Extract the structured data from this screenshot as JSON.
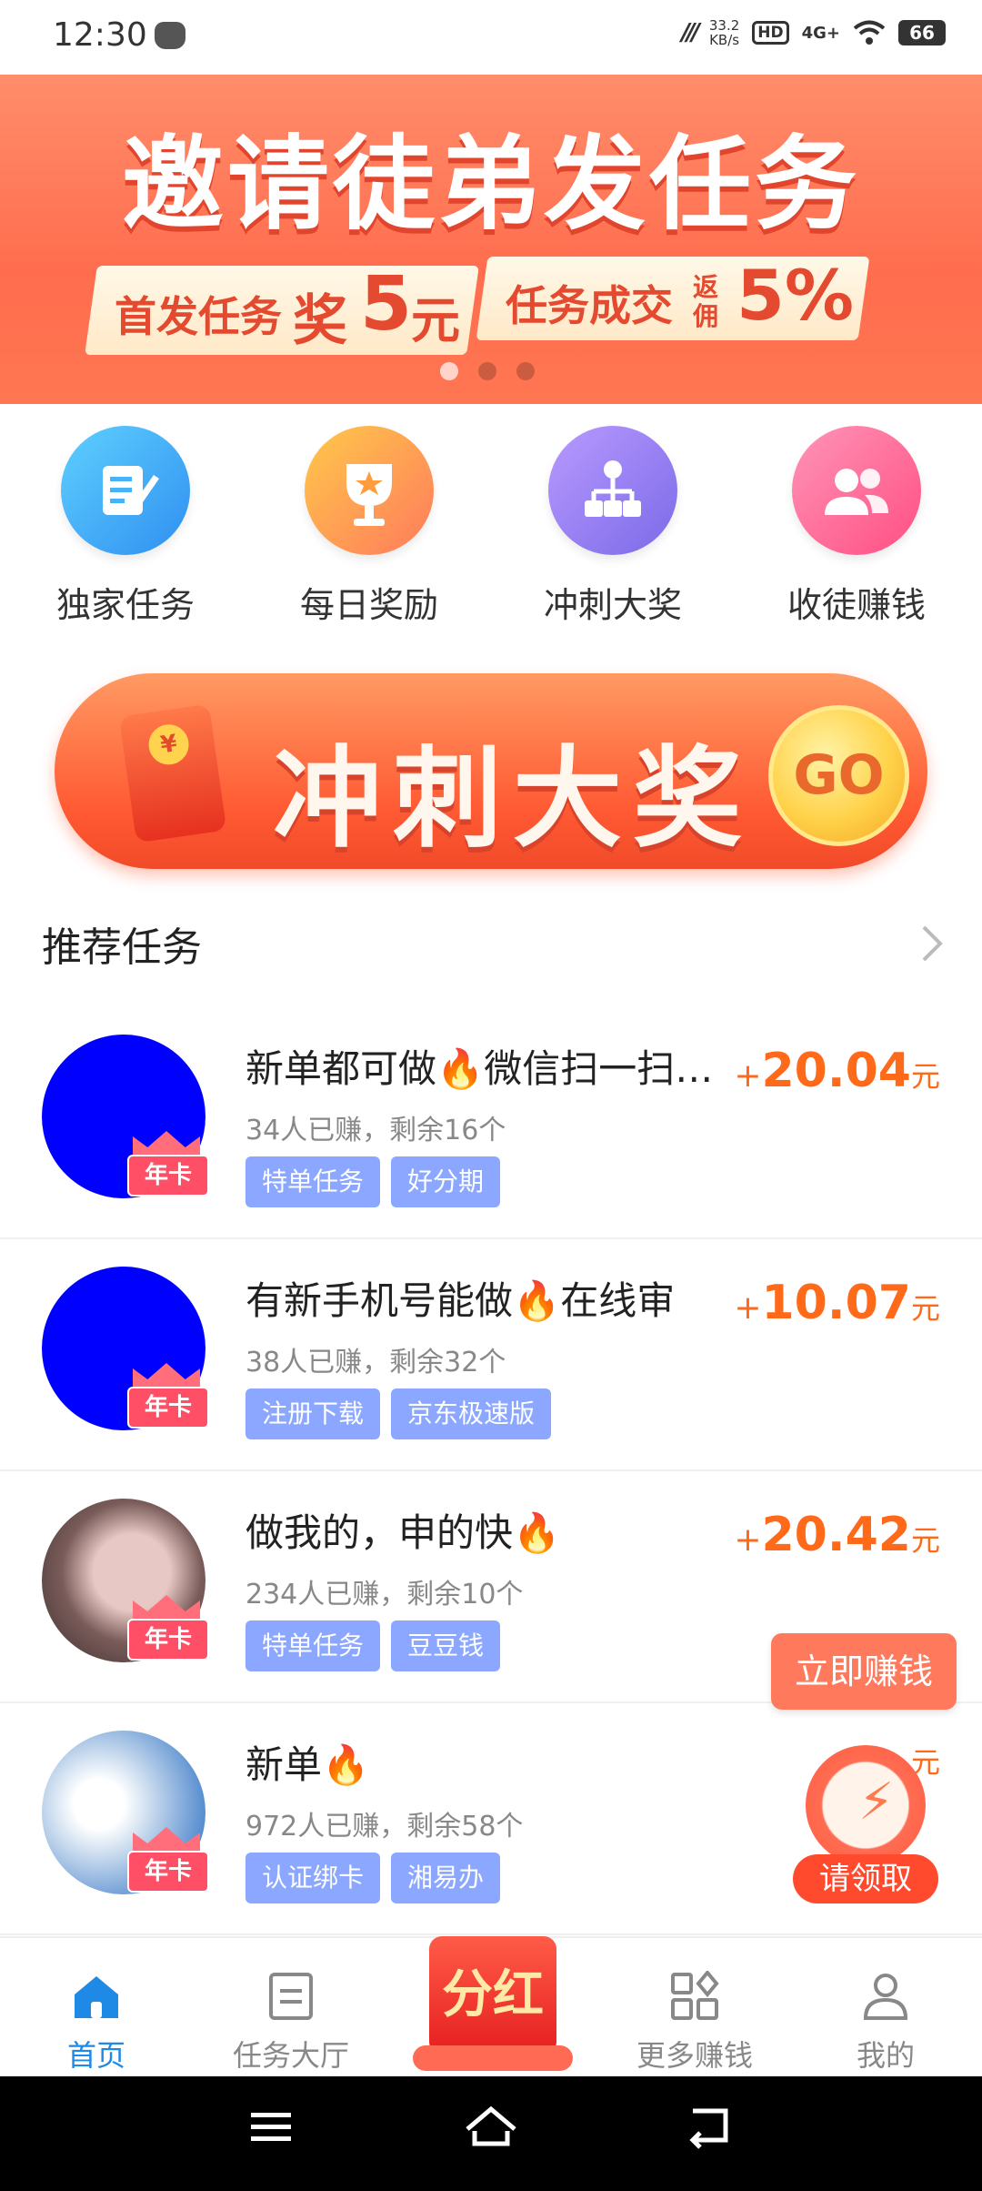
{
  "status_bar": {
    "time": "12:30",
    "speed_value": "33.2",
    "speed_unit": "KB/s",
    "hd": "HD",
    "network": "4G+",
    "battery": "66"
  },
  "banner": {
    "title": "邀请徒弟发任务",
    "reward1_prefix": "首发任务",
    "reward1_mid": "奖",
    "reward1_amount": "5",
    "reward1_unit": "元",
    "reward2_prefix": "任务成交",
    "reward2_badge": "返佣",
    "reward2_amount": "5%"
  },
  "quick_grid": [
    {
      "label": "独家任务",
      "icon": "edit-icon",
      "color": "#47b3f5"
    },
    {
      "label": "每日奖励",
      "icon": "trophy-icon",
      "color": "#ff9d3d"
    },
    {
      "label": "冲刺大奖",
      "icon": "hierarchy-icon",
      "color": "#9a7bf0"
    },
    {
      "label": "收徒赚钱",
      "icon": "users-icon",
      "color": "#ff6f97"
    }
  ],
  "rush_banner": {
    "text": "冲刺大奖",
    "coin": "¥",
    "go": "GO"
  },
  "section": {
    "title": "推荐任务"
  },
  "tasks": [
    {
      "title": "新单都可做🔥微信扫一扫…",
      "meta": "34人已赚，剩余16个",
      "tags": [
        "特单任务",
        "好分期"
      ],
      "sign": "+",
      "amount": "20.04",
      "unit": "元",
      "badge": "年卡"
    },
    {
      "title": "有新手机号能做🔥在线审",
      "meta": "38人已赚，剩余32个",
      "tags": [
        "注册下载",
        "京东极速版"
      ],
      "sign": "+",
      "amount": "10.07",
      "unit": "元",
      "badge": "年卡"
    },
    {
      "title": "做我的，申的快🔥",
      "meta": "234人已赚，剩余10个",
      "tags": [
        "特单任务",
        "豆豆钱"
      ],
      "sign": "+",
      "amount": "20.42",
      "unit": "元",
      "badge": "年卡"
    },
    {
      "title": "新单🔥",
      "meta": "972人已赚，剩余58个",
      "tags": [
        "认证绑卡",
        "湘易办"
      ],
      "sign": "",
      "amount": "",
      "unit": "元",
      "badge": "年卡"
    }
  ],
  "floating": {
    "earn_now": "立即赚钱",
    "claim": "请领取"
  },
  "bottom_nav": {
    "home": "首页",
    "task_hall": "任务大厅",
    "center": "分红",
    "more": "更多赚钱",
    "mine": "我的"
  },
  "colors": {
    "accent": "#1f8ae6",
    "reward": "#ff6a1a",
    "tag": "#8ba7ff"
  }
}
